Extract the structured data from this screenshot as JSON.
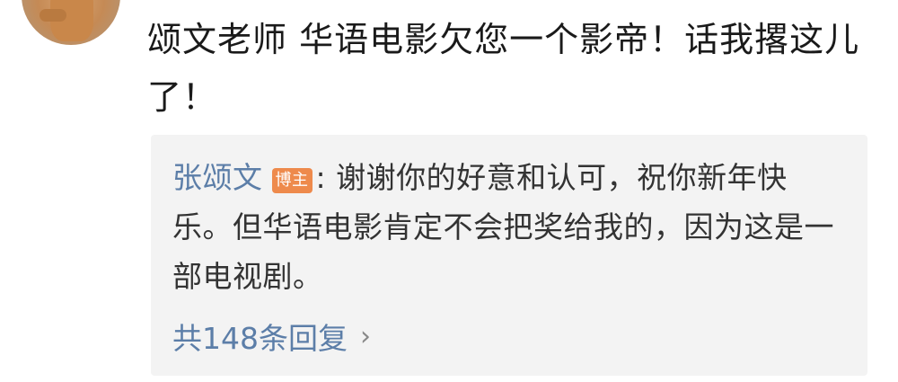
{
  "comment": {
    "text": "颂文老师 华语电影欠您一个影帝！话我撂这儿了！"
  },
  "reply": {
    "author": "张颂文",
    "badge": "博主",
    "separator": ":",
    "text": "谢谢你的好意和认可，祝你新年快乐。但华语电影肯定不会把奖给我的，因为这是一部电视剧。"
  },
  "replies_link": {
    "label": "共148条回复",
    "icon": "chevron-right-icon"
  }
}
